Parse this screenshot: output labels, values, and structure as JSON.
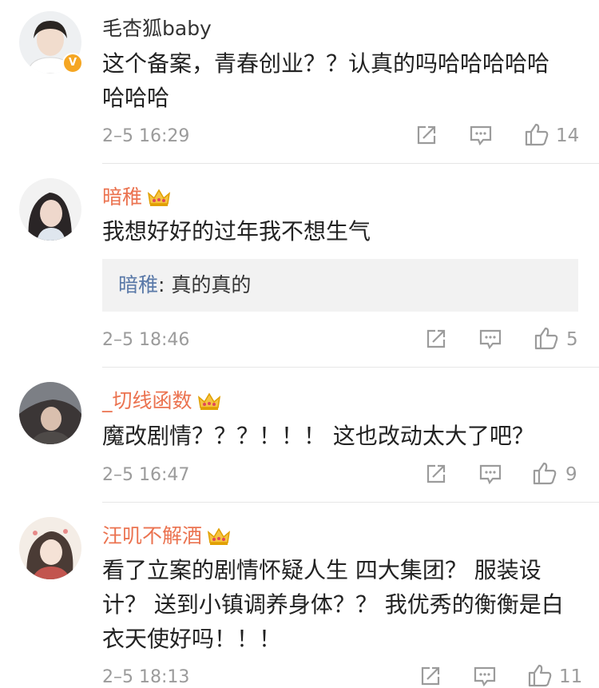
{
  "comments": [
    {
      "username": "毛杏狐baby",
      "verified": true,
      "text": "这个备案，青春创业？？认真的吗哈哈哈哈哈哈哈哈",
      "time": "2–5 16:29",
      "likes": "14"
    },
    {
      "username": "暗稚",
      "vip_crown": true,
      "text": "我想好好的过年我不想生气",
      "reply": {
        "name": "暗稚",
        "separator": ": ",
        "text": "真的真的"
      },
      "time": "2–5 18:46",
      "likes": "5"
    },
    {
      "username": "_切线函数",
      "vip_crown": true,
      "text": "魔改剧情？？？！！！ 这也改动太大了吧？",
      "time": "2–5 16:47",
      "likes": "9"
    },
    {
      "username": "汪叽不解酒",
      "vip_crown": true,
      "text": "看了立案的剧情怀疑人生 四大集团？ 服装设计？ 送到小镇调养身体？？ 我优秀的衡衡是白衣天使好吗！！！",
      "time": "2–5 18:13",
      "likes": "11"
    }
  ],
  "icons": {
    "share": "share-icon",
    "comment": "comment-icon",
    "like": "thumbs-up-icon",
    "crown": "crown-icon",
    "verified": "verified-badge-icon"
  },
  "colors": {
    "vip_name": "#eb7350",
    "reply_name": "#5a79a8",
    "meta": "#9b9b9b",
    "crown": "#f0b400"
  }
}
